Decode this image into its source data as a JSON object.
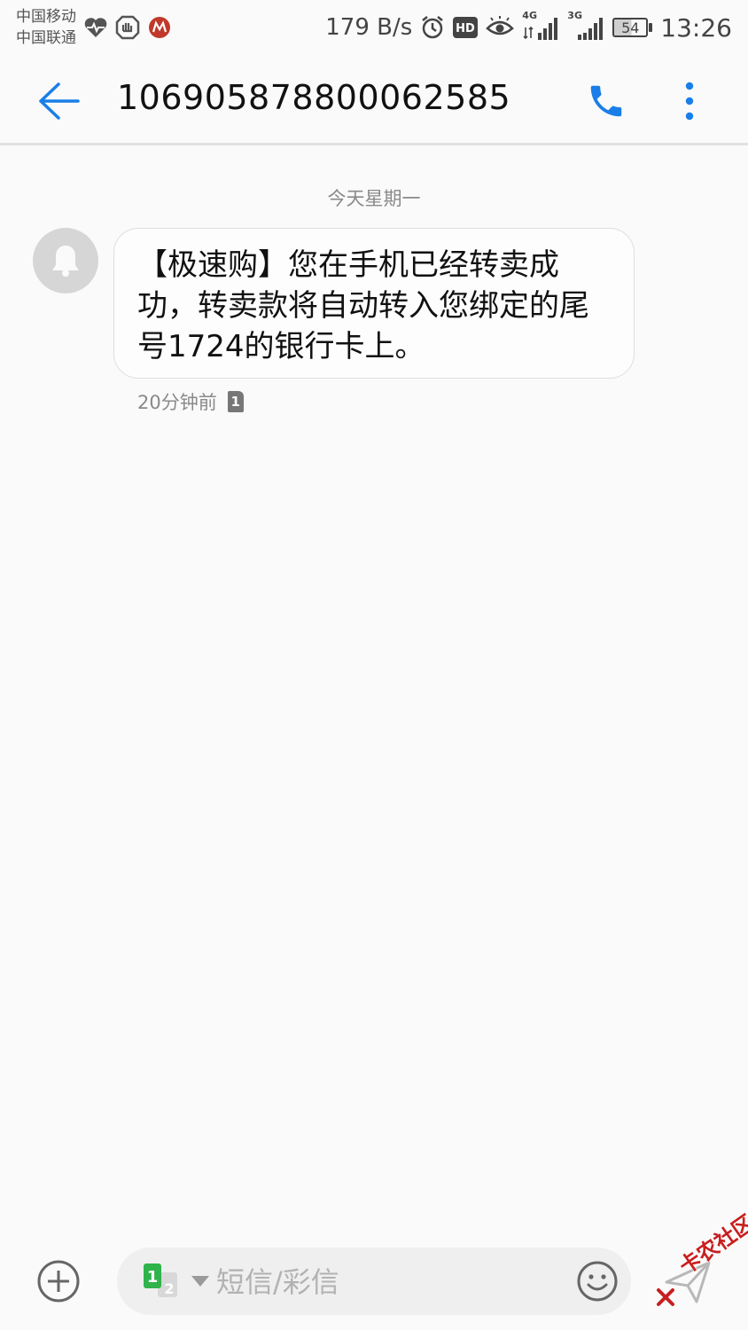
{
  "status_bar": {
    "carrier_1": "中国移动",
    "carrier_2": "中国联通",
    "net_speed": "179 B/s",
    "hd_label": "HD",
    "net_1": "4G",
    "net_2": "3G",
    "battery_level": "54",
    "time": "13:26",
    "icons": [
      "heart-monitor-icon",
      "shield-app-icon",
      "bank-app-icon",
      "alarm-icon",
      "hd-icon",
      "eye-icon",
      "signal-4g-icon",
      "signal-3g-icon",
      "battery-icon"
    ]
  },
  "app_bar": {
    "title": "106905878800062585",
    "icons": [
      "back-arrow-icon",
      "phone-call-icon",
      "more-vertical-icon"
    ]
  },
  "conversation": {
    "date_separator": "今天星期一",
    "messages": [
      {
        "text": "【极速购】您在手机已经转卖成功，转卖款将自动转入您绑定的尾号1724的银行卡上。",
        "time": "20分钟前",
        "sim": "1"
      }
    ]
  },
  "composer": {
    "placeholder": "短信/彩信",
    "sim_primary": "1",
    "sim_secondary": "2",
    "icons": [
      "add-circle-icon",
      "sim-switch-icon",
      "emoji-icon",
      "send-icon"
    ]
  },
  "watermark": {
    "text": "卡农社区"
  },
  "colors": {
    "accent": "#1a7ee8",
    "background": "#fafafa",
    "bubble_border": "#dedede",
    "sim_green": "#2fb34a"
  }
}
